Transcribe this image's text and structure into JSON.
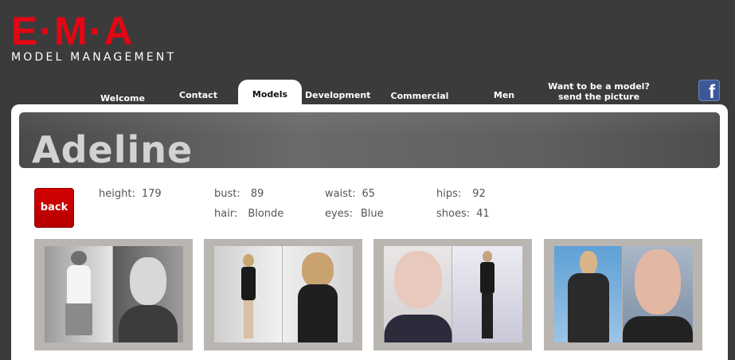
{
  "logo": {
    "main": "E·M·A",
    "sub": "MODEL MANAGEMENT"
  },
  "nav": {
    "items": [
      {
        "label": "Welcome"
      },
      {
        "label": "Contact"
      },
      {
        "label": "Models"
      },
      {
        "label": "Development"
      },
      {
        "label": "Commercial"
      },
      {
        "label": "Men"
      },
      {
        "label": "Want to be a model?",
        "label2": "send the picture"
      }
    ],
    "active": "Models"
  },
  "social": {
    "icon": "facebook-icon",
    "glyph": "f"
  },
  "model": {
    "name": "Adeline",
    "back_label": "back",
    "stats": [
      {
        "label": "height:",
        "value": "179"
      },
      {
        "label": "bust:",
        "value": "89"
      },
      {
        "label": "waist:",
        "value": "65"
      },
      {
        "label": "hips:",
        "value": "92"
      },
      {
        "label": "hair:",
        "value": "Blonde"
      },
      {
        "label": "eyes:",
        "value": "Blue"
      },
      {
        "label": "shoes:",
        "value": "41"
      }
    ]
  },
  "colors": {
    "background": "#3b3b3b",
    "brand_red": "#e30613",
    "panel": "#ffffff",
    "button_red": "#c80000"
  }
}
